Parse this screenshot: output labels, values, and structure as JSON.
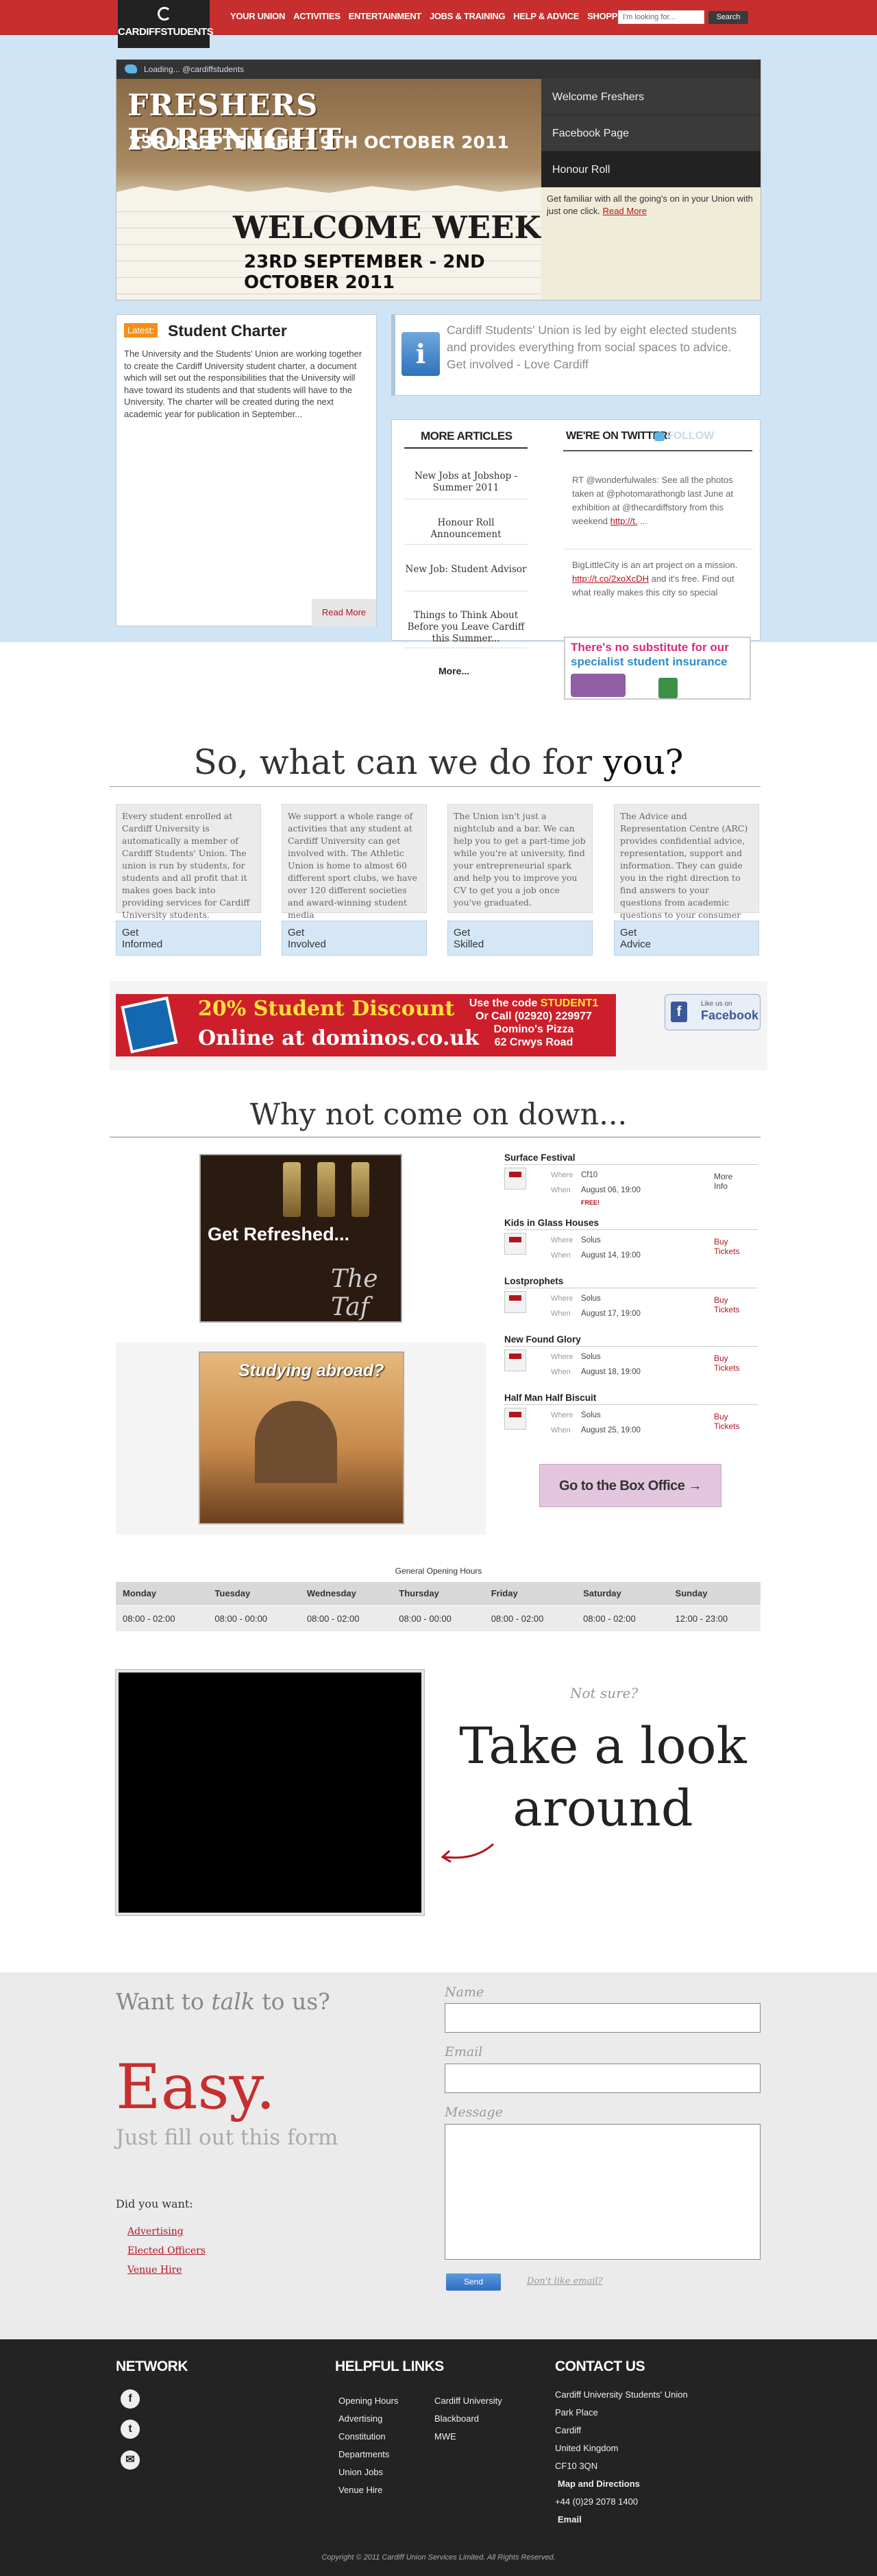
{
  "header": {
    "logo_text": "CARDIFFSTUDENTS",
    "nav": [
      "YOUR UNION",
      "ACTIVITIES",
      "ENTERTAINMENT",
      "JOBS & TRAINING",
      "HELP & ADVICE",
      "SHOPPING"
    ],
    "search_placeholder": "I'm looking for...",
    "search_button": "Search"
  },
  "hero": {
    "tweet_status": "Loading... @cardiffstudents",
    "banner_line1": "FRESHERS FORTNIGHT",
    "banner_line2": "23RD SEPTEMBER - 9TH OCTOBER 2011",
    "banner_line3": "WELCOME WEEK",
    "banner_line4": "23RD SEPTEMBER - 2ND OCTOBER 2011",
    "menu": [
      "Welcome Freshers",
      "Facebook Page",
      "Honour Roll"
    ],
    "description": "Get familiar with all the going's on in your Union with just one click.",
    "description_link": "Read More"
  },
  "latest": {
    "tag": "Latest:",
    "title": "Student Charter",
    "body": "The University and the Students' Union are working together to create the Cardiff University student charter, a document which will set out the responsibilities that the University will have toward its students and that students will have to the University. The charter will be created during the next academic year for publication in September...",
    "read_more": "Read More"
  },
  "info": {
    "icon": "i",
    "text": "Cardiff Students' Union is led by eight elected students and provides everything from social spaces to advice. Get involved - Love Cardiff"
  },
  "articles": {
    "heading": "MORE ARTICLES",
    "items": [
      "New Jobs at Jobshop - Summer 2011",
      "Honour Roll Announcement",
      "New Job: Student Advisor",
      "Things to Think About Before you Leave Cardiff this Summer..."
    ],
    "more": "More..."
  },
  "twitter": {
    "heading": "WE'RE ON TWITTER!",
    "follow": "FOLLOW",
    "tweets": [
      {
        "text": "RT @wonderfulwales: See all the photos taken at @photomarathongb last June at exhibition at @thecardiffstory from this weekend",
        "link": "http://t.",
        "tail": " ..."
      },
      {
        "text": "BigLittleCity is an art project on a mission.",
        "link": "http://t.co/2xoXcDH",
        "tail": " and it's free. Find out what really makes this city so special"
      }
    ],
    "ad_line1": "There's no substitute for our",
    "ad_line2": "specialist student insurance"
  },
  "services": {
    "heading_pre": "So, what can we do for ",
    "heading_em": "you?",
    "items": [
      {
        "text": "Every student enrolled at Cardiff University is automatically a member of Cardiff Students' Union. The union is run by students, for students and all profit that it makes goes back into providing services for Cardiff University students.",
        "button_l1": "Get",
        "button_l2": "Informed"
      },
      {
        "text": "We support a whole range of activities that any student at Cardiff University can get involved with. The Athletic Union is home to almost 60 different sport clubs, we have over 120 different societies and award-winning student media",
        "button_l1": "Get",
        "button_l2": "Involved"
      },
      {
        "text": "The Union isn't just a nightclub and a bar. We can help you to get a part-time job while you're at university, find your entrepreneurial spark and help you to improve you CV to get you a job once you've graduated.",
        "button_l1": "Get",
        "button_l2": "Skilled"
      },
      {
        "text": "The Advice and Representation Centre (ARC) provides confidential advice, representation, support and information. They can guide you in the right direction to find answers to your questions from academic questions to your consumer rights.",
        "button_l1": "Get",
        "button_l2": "Advice"
      }
    ]
  },
  "promo": {
    "headline": "20% Student Discount",
    "sub": "Online at dominos.co.uk",
    "code_pre": "Use the code ",
    "code": "STUDENT1",
    "phone": "Or Call (02920) 229977",
    "shop": "Domino's Pizza",
    "address": "62 Crwys Road",
    "fb_small": "Like us on",
    "fb_big": "Facebook"
  },
  "come_down": {
    "heading": "Why not come on down...",
    "taf_line1": "Get Refreshed...",
    "taf_line2": "The Taf",
    "study": "Studying abroad?"
  },
  "events": {
    "where_label": "Where",
    "when_label": "When",
    "items": [
      {
        "title": "Surface Festival",
        "where": "Cf10",
        "when": "August 06, 19:00",
        "note": "FREE!",
        "action": "More Info"
      },
      {
        "title": "Kids in Glass Houses",
        "where": "Solus",
        "when": "August 14, 19:00",
        "note": "",
        "action": "Buy Tickets"
      },
      {
        "title": "Lostprophets",
        "where": "Solus",
        "when": "August 17, 19:00",
        "note": "",
        "action": "Buy Tickets"
      },
      {
        "title": "New Found Glory",
        "where": "Solus",
        "when": "August 18, 19:00",
        "note": "",
        "action": "Buy Tickets"
      },
      {
        "title": "Half Man Half Biscuit",
        "where": "Solus",
        "when": "August 25, 19:00",
        "note": "",
        "action": "Buy Tickets"
      }
    ],
    "box_office": "Go to the Box Office →"
  },
  "hours": {
    "title": "General Opening Hours",
    "days": [
      "Monday",
      "Tuesday",
      "Wednesday",
      "Thursday",
      "Friday",
      "Saturday",
      "Sunday"
    ],
    "times": [
      "08:00 - 02:00",
      "08:00 - 00:00",
      "08:00 - 02:00",
      "08:00 - 00:00",
      "08:00 - 02:00",
      "08:00 - 02:00",
      "12:00 - 23:00"
    ]
  },
  "tour": {
    "not_sure": "Not sure?",
    "line1": "Take a look",
    "line2": "around"
  },
  "contact": {
    "want_pre": "Want to ",
    "want_em": "talk",
    "want_post": " to us?",
    "easy": "Easy.",
    "fill": "Just fill out this form",
    "did_you": "Did you want:",
    "links": [
      "Advertising",
      "Elected Officers",
      "Venue Hire"
    ],
    "name_label": "Name",
    "email_label": "Email",
    "message_label": "Message",
    "send": "Send",
    "dont_like": "Don't like email?"
  },
  "footer": {
    "network_heading": "NETWORK",
    "network_icons": [
      "f",
      "t",
      "✉"
    ],
    "links_heading": "HELPFUL LINKS",
    "links_col1": [
      "Opening Hours",
      "Advertising",
      "Constitution",
      "Departments",
      "Union Jobs",
      "Venue Hire"
    ],
    "links_col2": [
      "Cardiff University",
      "Blackboard",
      "MWE"
    ],
    "contact_heading": "CONTACT US",
    "address": [
      "Cardiff University Students' Union",
      "Park Place",
      "Cardiff",
      "United Kingdom",
      "CF10 3QN"
    ],
    "map": "Map and Directions",
    "phone": "+44 (0)29 2078 1400",
    "email": "Email",
    "copyright": "Copyright © 2011 Cardiff Union Services Limited. All Rights Reserved."
  }
}
